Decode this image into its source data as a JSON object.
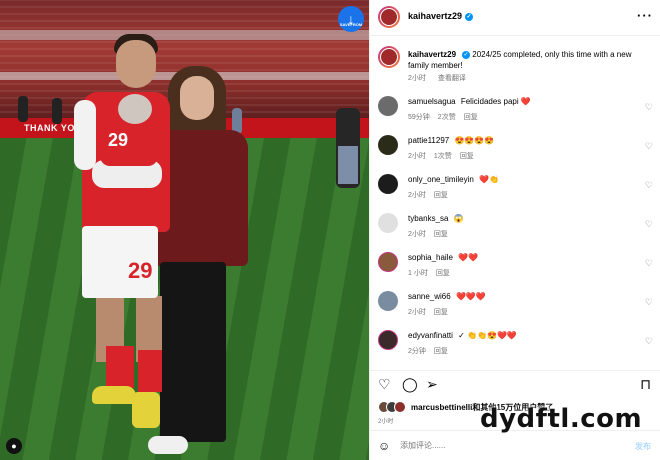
{
  "download_badge": {
    "label": "SAVEFROM"
  },
  "photo": {
    "ad_text": "THANK YOU",
    "player_number": "29",
    "baby_number": "29"
  },
  "header": {
    "username": "kaihavertz29",
    "verified": "✓",
    "more": "···"
  },
  "caption": {
    "username": "kaihavertz29",
    "text": "2024/25 completed, only this time with a new family member!",
    "time": "2小时",
    "translate": "查看翻译"
  },
  "comments": [
    {
      "username": "samuelsagua",
      "text": "Felicidades papi ❤️",
      "time": "59分钟",
      "likes": "2次赞",
      "reply": "回复"
    },
    {
      "username": "pattie11297",
      "text": "😍😍😍😍",
      "time": "2小时",
      "likes": "1次赞",
      "reply": "回复"
    },
    {
      "username": "only_one_timileyin",
      "text": "❤️👏",
      "time": "2小时",
      "likes": "",
      "reply": "回复"
    },
    {
      "username": "tybanks_sa",
      "text": "😱",
      "time": "2小时",
      "likes": "",
      "reply": "回复"
    },
    {
      "username": "sophia_haile",
      "text": "❤️❤️",
      "time": "1 小时",
      "likes": "",
      "reply": "回复"
    },
    {
      "username": "sanne_wi66",
      "text": "❤️❤️❤️",
      "time": "2小时",
      "likes": "",
      "reply": "回复"
    },
    {
      "username": "edyvanfinatti",
      "text": "✓ 👏👏😍❤️❤️",
      "time": "2分钟",
      "likes": "",
      "reply": "回复"
    }
  ],
  "likes_text": "marcusbettinelli和其他15万位用户赞了",
  "date": "2小时",
  "add_comment": {
    "placeholder": "添加评论......",
    "post": "发布"
  },
  "watermark": "dydftl.com",
  "icons": {
    "heart": "♡",
    "comment": "◯",
    "share": "➢",
    "save": "⊓",
    "emoji": "☺"
  }
}
